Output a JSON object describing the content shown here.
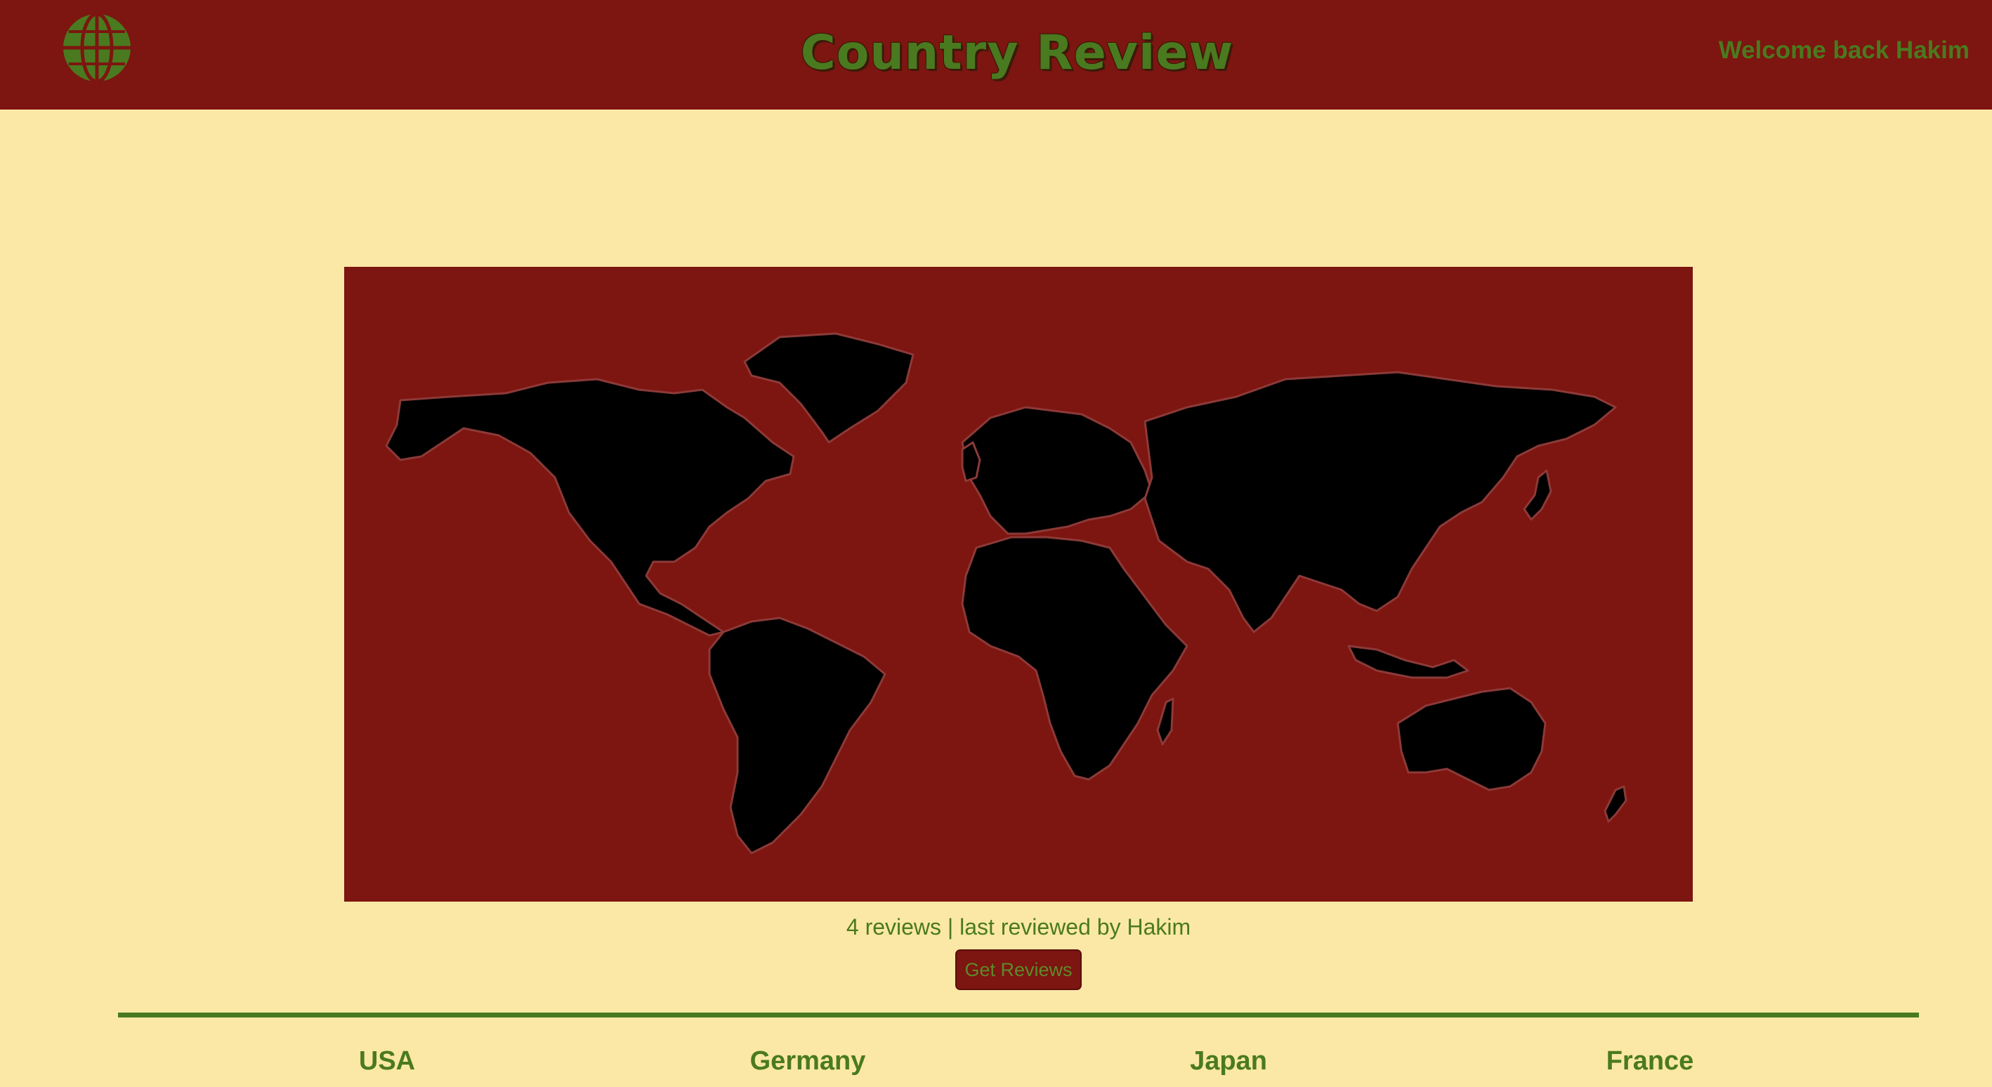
{
  "header": {
    "logo_icon": "globe-icon",
    "title": "Country Review",
    "welcome": "Welcome back Hakim"
  },
  "map": {
    "icon": "world-map"
  },
  "reviews": {
    "info": "4 reviews | last reviewed by Hakim",
    "button_label": "Get Reviews"
  },
  "countries": [
    {
      "label": "USA"
    },
    {
      "label": "Germany"
    },
    {
      "label": "Japan"
    },
    {
      "label": "France"
    }
  ],
  "colors": {
    "background": "#fbe8a6",
    "header": "#7d1510",
    "accent": "#4a7a1f",
    "land": "#000000"
  }
}
